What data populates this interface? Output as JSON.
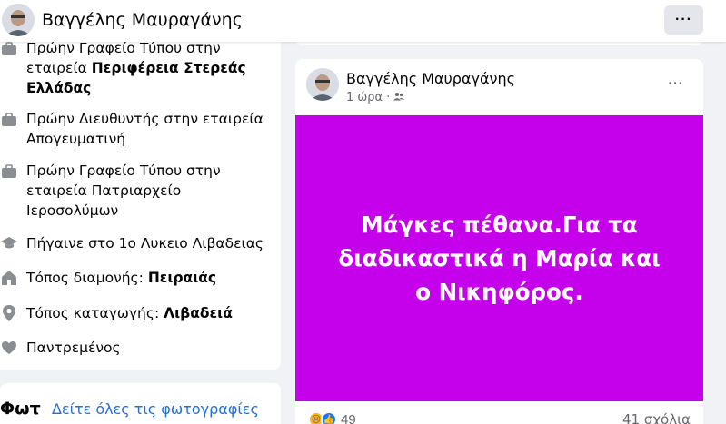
{
  "header": {
    "name": "Βαγγέλης Μαυραγάνης",
    "more_label": "···"
  },
  "intro": {
    "items": [
      {
        "icon": "briefcase-icon",
        "prefix": "Πρώην Γραφείο Τύπου στην εταιρεία ",
        "bold": "Περιφέρεια Στερεάς Ελλάδας"
      },
      {
        "icon": "briefcase-icon",
        "prefix": "Πρώην Διευθυντής στην εταιρεία Απογευματινή",
        "bold": ""
      },
      {
        "icon": "briefcase-icon",
        "prefix": "Πρώην Γραφείο Τύπου στην εταιρεία Πατριαρχείο Ιεροσολύμων",
        "bold": ""
      },
      {
        "icon": "graduation-cap-icon",
        "prefix": "Πήγαινε στο 1ο Λυκειο Λιβαδειας",
        "bold": ""
      },
      {
        "icon": "home-icon",
        "prefix": "Τόπος διαμονής: ",
        "bold": "Πειραιάς"
      },
      {
        "icon": "location-pin-icon",
        "prefix": "Τόπος καταγωγής: ",
        "bold": "Λιβαδειά"
      },
      {
        "icon": "heart-icon",
        "prefix": "Παντρεμένος",
        "bold": ""
      }
    ]
  },
  "photos": {
    "title": "Φωτ",
    "see_all": "Δείτε όλες τις φωτογραφίες"
  },
  "post": {
    "author": "Βαγγέλης Μαυραγάνης",
    "time": "1 ώρα",
    "separator": "·",
    "audience_icon": "friends-icon",
    "more_label": "···",
    "text": "Μάγκες πέθανα.Για τα διαδικαστικά η Μαρία και ο Νικηφόρος.",
    "background_color": "#c500ea",
    "reaction_count": "49",
    "comments": "41 σχόλια"
  }
}
